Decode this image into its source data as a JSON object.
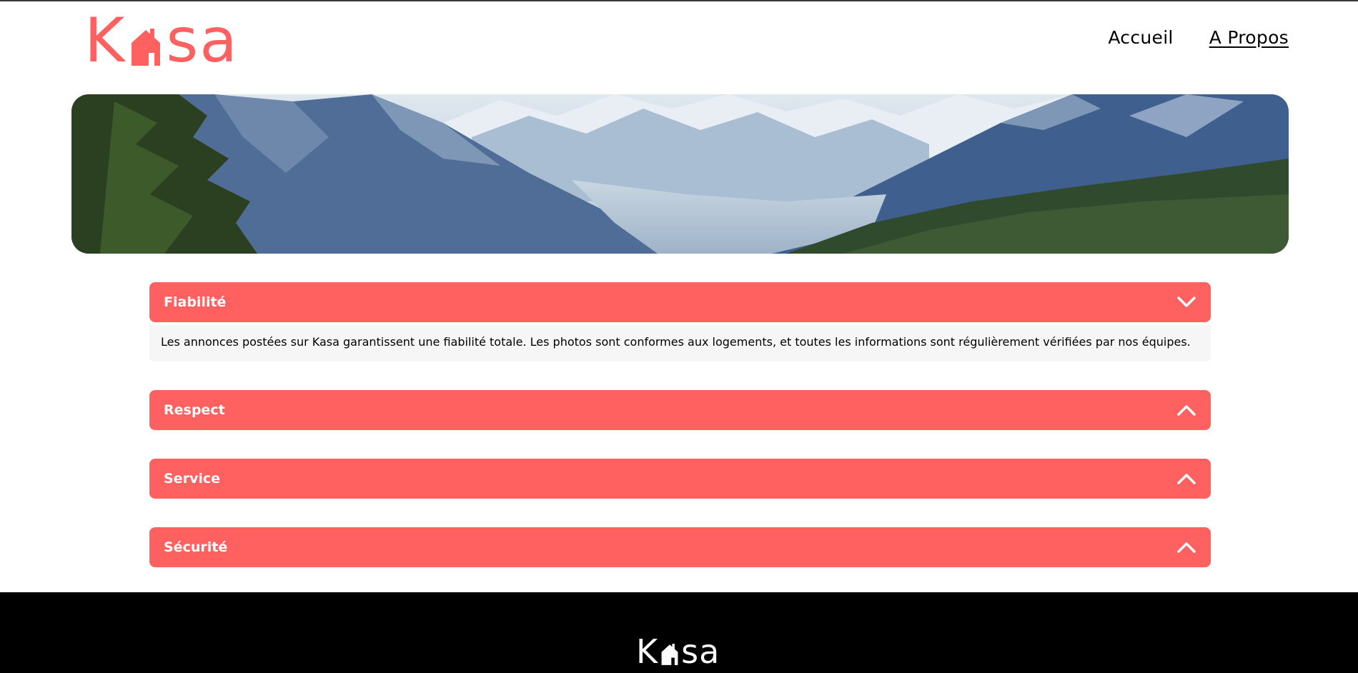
{
  "brand": {
    "name_prefix": "K",
    "name_suffix": "sa",
    "color": "#FF6060"
  },
  "nav": {
    "items": [
      {
        "label": "Accueil",
        "active": false
      },
      {
        "label": "A Propos",
        "active": true
      }
    ]
  },
  "accordion": {
    "items": [
      {
        "title": "Fiabilité",
        "open": true,
        "icon": "chevron-down-icon",
        "content": "Les annonces postées sur Kasa garantissent une fiabilité totale. Les photos sont conformes aux logements, et toutes les informations sont régulièrement vérifiées par nos équipes."
      },
      {
        "title": "Respect",
        "open": false,
        "icon": "chevron-up-icon"
      },
      {
        "title": "Service",
        "open": false,
        "icon": "chevron-up-icon"
      },
      {
        "title": "Sécurité",
        "open": false,
        "icon": "chevron-up-icon"
      }
    ]
  },
  "footer": {
    "logo_prefix": "K",
    "logo_suffix": "sa"
  }
}
